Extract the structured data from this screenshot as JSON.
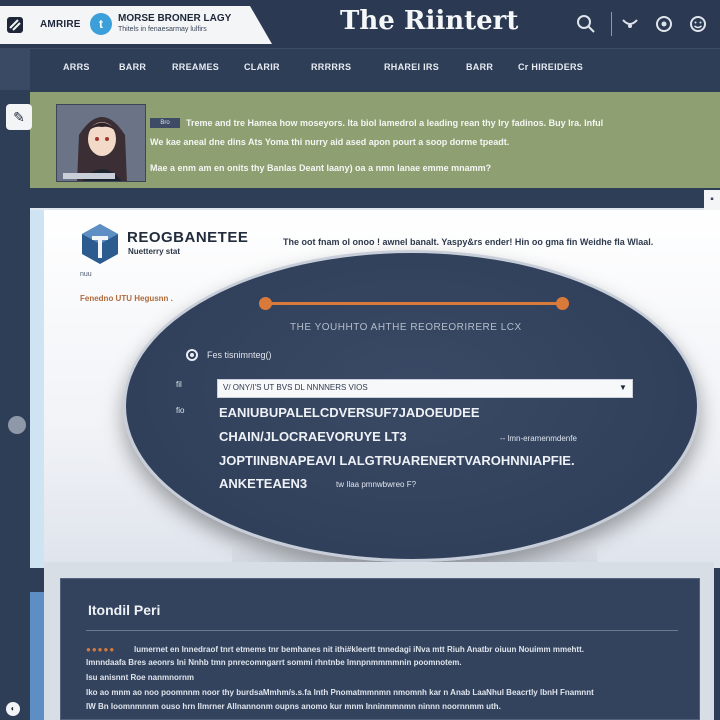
{
  "header": {
    "brand_small": "AMRIRE",
    "brand_name": "MORSE BRONER LAGY",
    "brand_sub": "Thitels in fenaesarmay lulfirs",
    "site_title": "The Riintert",
    "icons": [
      "search-icon",
      "messages-icon",
      "help-icon",
      "emoji-icon"
    ]
  },
  "nav": {
    "items": [
      "ARRS",
      "BARR",
      "RREAMES",
      "CLARIR",
      "RRRRRS",
      "RHAREI IRS",
      "BARR",
      "Cr HIREIDERS"
    ]
  },
  "banner": {
    "tag": "Bro",
    "lines": [
      "Treme and tre Hamea how moseyors. Ita biol Iamedrol a leading rean thy Iry fadinos. Buy Ira. Inful",
      "We kae aneal dne dins Ats Yoma thi nurry aid ased apon pourt a soop dorme tpeadt.",
      "Mae a enm am en onits thy Banlas Deant laany) oa a nmn lanae emme mnamm?"
    ]
  },
  "page": {
    "brand": "REOGBANETEE",
    "brand_sub": "Nuetterry stat",
    "blurb": "The oot fnam ol onoo ! awnel banalt. Yaspy&rs ender! Hin oo gma fin Weidhe fla Wlaal.",
    "pill": "nuu",
    "crumb": "Fenedno UTU Hegusnn ."
  },
  "dialog": {
    "title": "THE YOUHHTO AHTHE REOREORIRERE LCX",
    "radio_label": "Fes tisnimnteg()",
    "field_label_1": "fil",
    "field_label_2": "fio",
    "select_value": "V/ ONY/I'S UT BVS DL NNNNERS VIOS",
    "lines": [
      "EANIUBUPALELCDVERSUF7JADOEUDEE",
      "CHAIN/JLOCRAEVORUYE LT3",
      "JOPTIINBNAPEAVI LALGTRUARENERTVAROHNNIAPFIE.",
      "ANKETEAEN3"
    ],
    "line_2_suffix": "-- lmn-eramenmdenfe",
    "line_4_suffix": "tw Ilaa pmnwbwreo F?"
  },
  "bottom": {
    "title": "Itondil Peri",
    "rating": "●●●●●",
    "lines": [
      "lumernet en Innedraof tnrt etmems tnr bemhanes nit ithi#kleertt tnnedagi iNva mtt Riuh Anatbr oiuun Nouimm mmehtt.",
      "Imnndaafa Bres aeonrs Ini Nnhb tmn pnrecomngarrt sommi rhntnbe lmnpnmmmmnin poomnotem.",
      "Isu anisnnt Roe nanmnornm",
      "Iko ao mnm ao noo poomnnm noor thy burdsaMmhm/s.s.fa lnth Pnomatmmnmn nmomnh kar n Anab LaaNhul Beacrtly lbnH Fnamnnt",
      "IW Bn Ioomnmnnm ouso hrn Ilmrner Allnannonm oupns anomo kur mnm Inninmmnmn ninnn noornnmm uth."
    ]
  },
  "colors": {
    "header_bg": "#2b3a52",
    "banner_bg": "#8e9f72",
    "accent": "#d97a3a",
    "twitter": "#3b9fd9",
    "oval_bg": "#30405a"
  }
}
